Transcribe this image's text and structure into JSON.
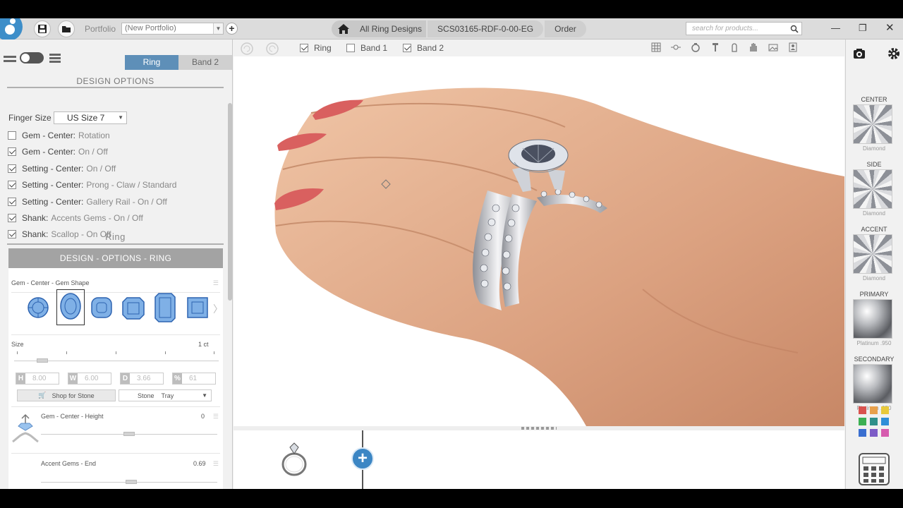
{
  "topbar": {
    "portfolio_label": "Portfolio",
    "portfolio_value": "(New Portfolio)",
    "breadcrumbs": [
      "All Ring Designs",
      "SCS03165-RDF-0-00-EG",
      "Order"
    ],
    "search_placeholder": "search for products..."
  },
  "left_panel": {
    "tabs": [
      "Ring",
      "Band 2"
    ],
    "active_tab": "Ring",
    "design_options_title": "DESIGN OPTIONS",
    "finger_size_label": "Finger Size",
    "finger_size_value": "US Size 7",
    "options": [
      {
        "key": "Gem - Center:",
        "value": "Rotation",
        "checked": false
      },
      {
        "key": "Gem - Center:",
        "value": "On / Off",
        "checked": true
      },
      {
        "key": "Setting - Center:",
        "value": "On / Off",
        "checked": true
      },
      {
        "key": "Setting - Center:",
        "value": "Prong - Claw / Standard",
        "checked": true
      },
      {
        "key": "Setting - Center:",
        "value": "Gallery Rail - On / Off",
        "checked": true
      },
      {
        "key": "Shank:",
        "value": "Accents Gems - On / Off",
        "checked": true
      },
      {
        "key": "Shank:",
        "value": "Scallop - On Off",
        "checked": true
      }
    ],
    "ring_section_title": "Ring",
    "design_options_ring_title": "DESIGN - OPTIONS - RING",
    "gem_shape_label": "Gem - Center - Gem Shape",
    "size_label": "Size",
    "size_value": "1 ct",
    "dimensions": [
      {
        "letter": "H",
        "value": "8.00"
      },
      {
        "letter": "W",
        "value": "6.00"
      },
      {
        "letter": "D",
        "value": "3.66"
      },
      {
        "letter": "%",
        "value": "61"
      }
    ],
    "shop_for_stone": "Shop for Stone",
    "stone_label": "Stone",
    "tray_label": "Tray",
    "height_label": "Gem - Center - Height",
    "height_value": "0",
    "accent_end_label": "Accent Gems - End",
    "accent_end_value": "0.69"
  },
  "toolbar": {
    "layers": [
      {
        "label": "Ring",
        "checked": true
      },
      {
        "label": "Band 1",
        "checked": false
      },
      {
        "label": "Band 2",
        "checked": true
      }
    ]
  },
  "right_panel": {
    "materials": [
      {
        "heading": "CENTER",
        "caption": "Diamond"
      },
      {
        "heading": "SIDE",
        "caption": "Diamond"
      },
      {
        "heading": "ACCENT",
        "caption": "Diamond"
      },
      {
        "heading": "PRIMARY",
        "caption": "Platinum .950"
      },
      {
        "heading": "SECONDARY",
        "caption": "Platinum .950"
      }
    ],
    "palette": [
      "#d9534f",
      "#e8a04b",
      "#e8c93b",
      "#3cb054",
      "#2f8f8a",
      "#2f8ed8",
      "#3a6fd0",
      "#7d5cc7",
      "#d65cae"
    ]
  },
  "colors": {
    "accent": "#5e8fb8",
    "add_button": "#3c86c4"
  }
}
